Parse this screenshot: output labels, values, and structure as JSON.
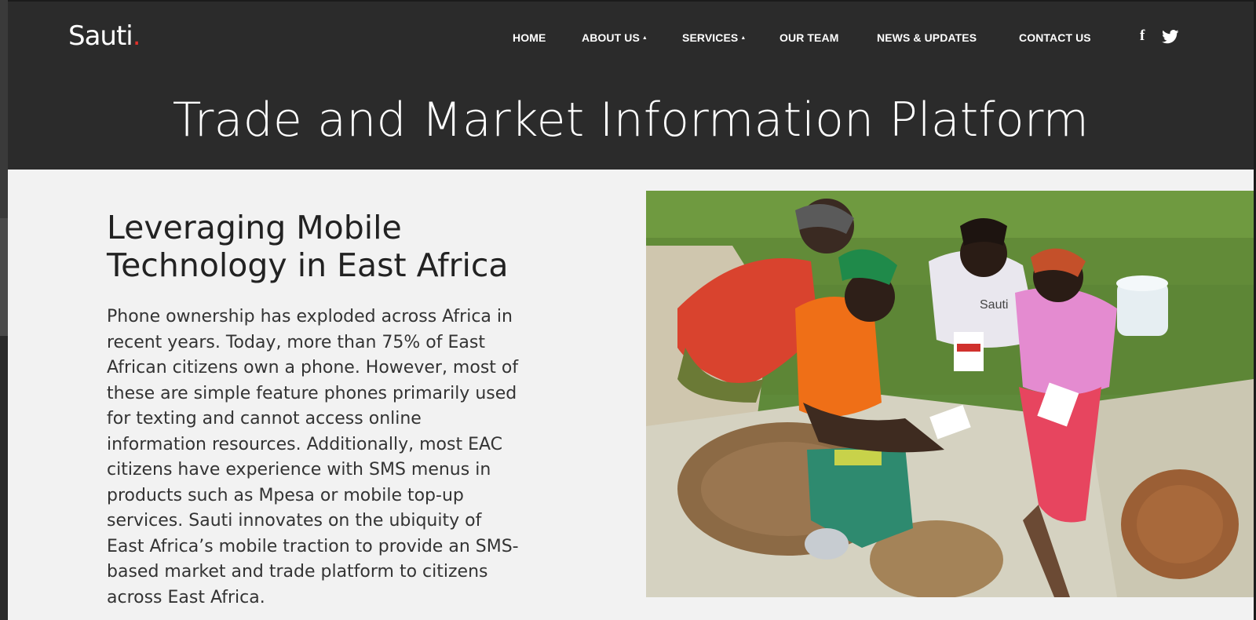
{
  "brand": {
    "name": "Sauti",
    "dot": "."
  },
  "nav": {
    "items": [
      {
        "label": "HOME",
        "caret": ""
      },
      {
        "label": "ABOUT US",
        "caret": "▲"
      },
      {
        "label": "SERVICES",
        "caret": "▲"
      },
      {
        "label": "OUR TEAM",
        "caret": ""
      },
      {
        "label": "NEWS & UPDATES",
        "caret": ""
      },
      {
        "label": "CONTACT US",
        "caret": ""
      }
    ],
    "social": {
      "facebook": "f",
      "twitter_icon": "twitter-icon"
    }
  },
  "hero": {
    "title": "Trade and Market Information Platform"
  },
  "content": {
    "heading_line1": "Leveraging Mobile",
    "heading_line2": "Technology in East Africa",
    "paragraph": "Phone ownership has exploded across Africa in recent years. Today, more than 75% of East African citizens own a phone. However, most of these are simple feature phones primarily used for texting and cannot access online information resources. Additionally, most EAC citizens have experience with SMS menus in products such as Mpesa or mobile top-up services. Sauti innovates on the ubiquity of East Africa’s mobile traction to provide an SMS-based market and trade platform to citizens across East Africa.",
    "photo_shirt_text": "Sauti"
  },
  "colors": {
    "header_bg": "#2b2b2b",
    "page_bg": "#f2f2f2",
    "accent": "#e0312b"
  }
}
